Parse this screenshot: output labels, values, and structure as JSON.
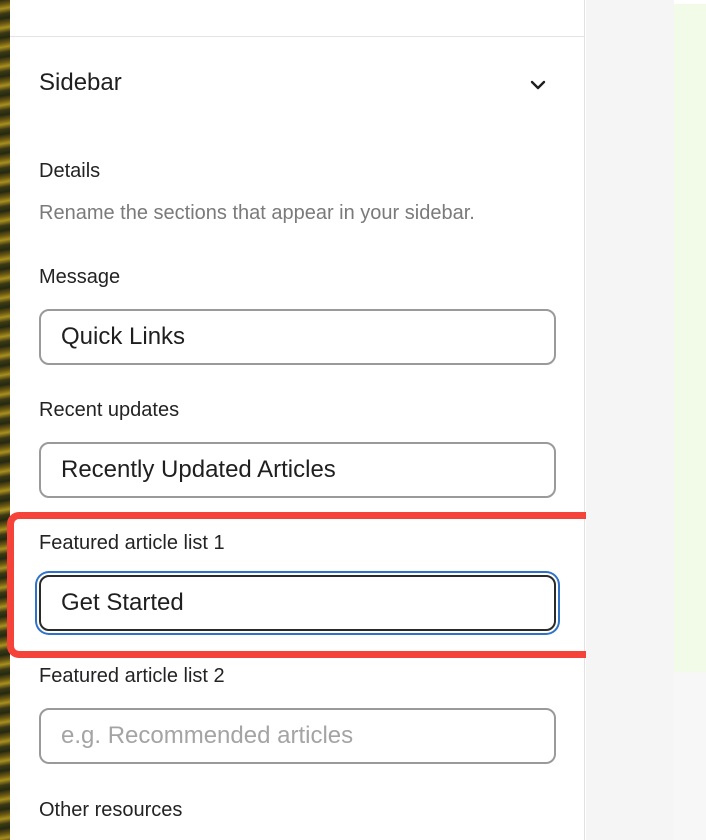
{
  "section": {
    "title": "Sidebar",
    "chevron_icon": "chevron-down-icon"
  },
  "details": {
    "heading": "Details",
    "description": "Rename the sections that appear in your sidebar."
  },
  "fields": {
    "message": {
      "label": "Message",
      "value": "Quick Links"
    },
    "recent_updates": {
      "label": "Recent updates",
      "value": "Recently Updated Articles"
    },
    "featured_1": {
      "label": "Featured article list 1",
      "value": "Get Started"
    },
    "featured_2": {
      "label": "Featured article list 2",
      "value": "",
      "placeholder": "e.g. Recommended articles"
    },
    "other_resources": {
      "label": "Other resources"
    }
  },
  "colors": {
    "highlight": "#f5433a",
    "focus_ring": "#2f73c9",
    "preview_bg": "#f2fbe8"
  }
}
